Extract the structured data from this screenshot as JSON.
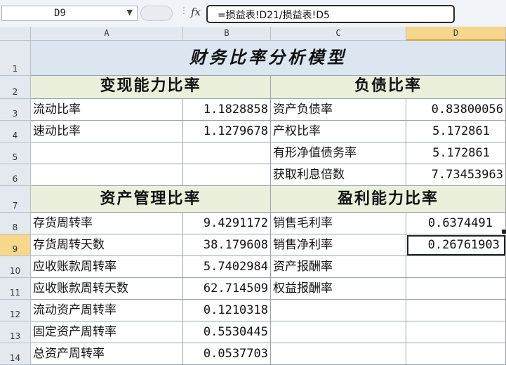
{
  "formula_bar": {
    "name_box": "D9",
    "fx_label": "fx",
    "formula": "=损益表!D21/损益表!D5"
  },
  "columns": [
    "A",
    "B",
    "C",
    "D"
  ],
  "rows": [
    "1",
    "2",
    "3",
    "4",
    "5",
    "6",
    "7",
    "8",
    "9",
    "10",
    "11",
    "12",
    "13",
    "14"
  ],
  "selected": {
    "column": "D",
    "row": "9"
  },
  "sheet": {
    "title": "财务比率分析模型",
    "sections": {
      "liquidity": "变现能力比率",
      "debt": "负债比率",
      "asset_mgmt": "资产管理比率",
      "profitability": "盈利能力比率"
    },
    "liquidity_rows": [
      {
        "label": "流动比率",
        "value": "1.1828858"
      },
      {
        "label": "速动比率",
        "value": "1.1279678"
      }
    ],
    "debt_rows": [
      {
        "label": "资产负债率",
        "value": "0.83800056"
      },
      {
        "label": "产权比率",
        "value": "5.172861"
      },
      {
        "label": "有形净值债务率",
        "value": "5.172861"
      },
      {
        "label": "获取利息倍数",
        "value": "7.73453963"
      }
    ],
    "asset_rows": [
      {
        "label": "存货周转率",
        "value": "9.4291172"
      },
      {
        "label": "存货周转天数",
        "value": "38.179608"
      },
      {
        "label": "应收账款周转率",
        "value": "5.7402984"
      },
      {
        "label": "应收账款周转天数",
        "value": "62.714509"
      },
      {
        "label": "流动资产周转率",
        "value": "0.1210318"
      },
      {
        "label": "固定资产周转率",
        "value": "0.5530445"
      },
      {
        "label": "总资产周转率",
        "value": "0.0537703"
      }
    ],
    "profit_rows": [
      {
        "label": "销售毛利率",
        "value": "0.6374491"
      },
      {
        "label": "销售净利率",
        "value": "0.26761903"
      },
      {
        "label": "资产报酬率",
        "value": ""
      },
      {
        "label": "权益报酬率",
        "value": ""
      }
    ]
  }
}
